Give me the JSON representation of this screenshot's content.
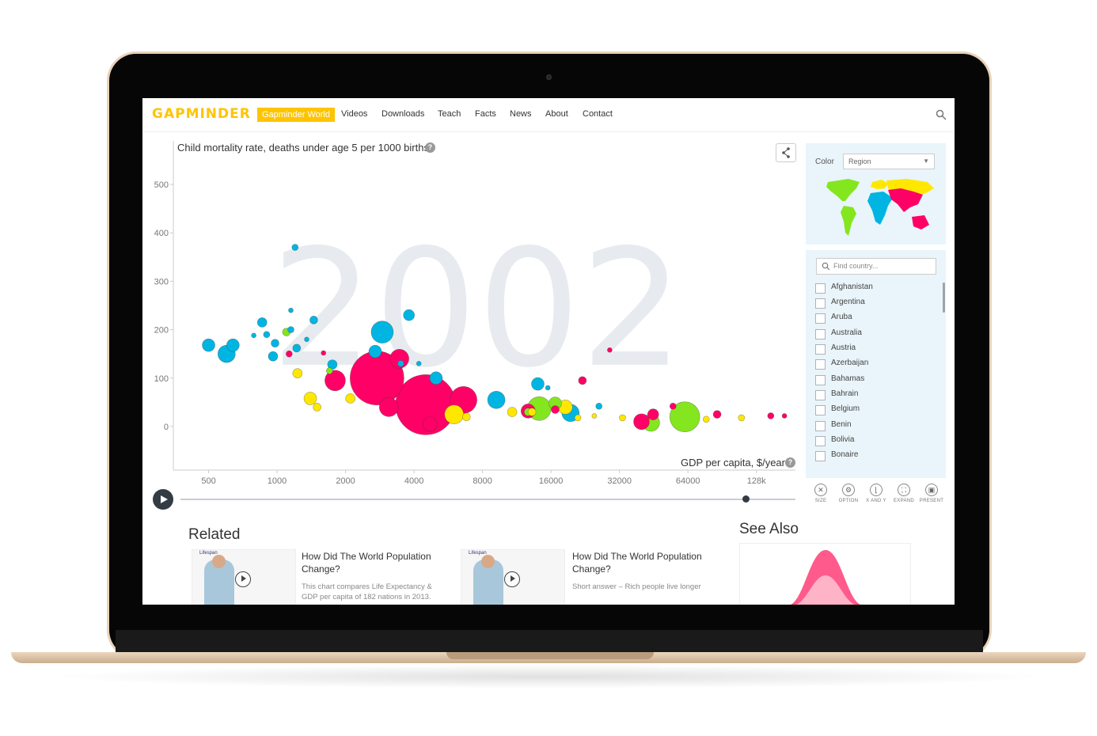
{
  "nav": {
    "logo": "GAPMINDER",
    "active": "Gapminder World",
    "items": [
      "Videos",
      "Downloads",
      "Teach",
      "Facts",
      "News",
      "About",
      "Contact"
    ]
  },
  "chart": {
    "y_title": "Child mortality rate, deaths under age 5 per 1000 births",
    "x_title": "GDP per capita, $/year",
    "help": "?",
    "year": "2002"
  },
  "chart_data": {
    "type": "scatter",
    "xlabel": "GDP per capita, $/year",
    "ylabel": "Child mortality rate, deaths under age 5 per 1000 births",
    "x_scale": "log",
    "xlim": [
      350,
      190000
    ],
    "ylim": [
      -90,
      590
    ],
    "x_ticks": [
      500,
      1000,
      2000,
      4000,
      8000,
      16000,
      32000,
      64000,
      128000
    ],
    "x_tick_labels": [
      "500",
      "1000",
      "2000",
      "4000",
      "8000",
      "16000",
      "32000",
      "64000",
      "128k"
    ],
    "y_ticks": [
      0,
      100,
      200,
      300,
      400,
      500
    ],
    "year_label": "2002",
    "region_colors": {
      "africa": "#00b5e2",
      "asia": "#ff0066",
      "americas": "#84e61f",
      "europe": "#ffe700"
    },
    "points": [
      {
        "x": 1200,
        "y": 370,
        "r": 4,
        "region": "africa"
      },
      {
        "x": 640,
        "y": 168,
        "r": 8,
        "region": "africa"
      },
      {
        "x": 860,
        "y": 215,
        "r": 6,
        "region": "africa"
      },
      {
        "x": 1150,
        "y": 240,
        "r": 3,
        "region": "africa"
      },
      {
        "x": 980,
        "y": 172,
        "r": 5,
        "region": "africa"
      },
      {
        "x": 900,
        "y": 190,
        "r": 4,
        "region": "africa"
      },
      {
        "x": 1450,
        "y": 220,
        "r": 5,
        "region": "africa"
      },
      {
        "x": 600,
        "y": 150,
        "r": 11,
        "region": "africa"
      },
      {
        "x": 960,
        "y": 145,
        "r": 6,
        "region": "africa"
      },
      {
        "x": 1150,
        "y": 200,
        "r": 4,
        "region": "africa"
      },
      {
        "x": 790,
        "y": 188,
        "r": 3,
        "region": "africa"
      },
      {
        "x": 1350,
        "y": 180,
        "r": 3,
        "region": "africa"
      },
      {
        "x": 1220,
        "y": 162,
        "r": 5,
        "region": "africa"
      },
      {
        "x": 500,
        "y": 168,
        "r": 8,
        "region": "africa"
      },
      {
        "x": 2900,
        "y": 195,
        "r": 14,
        "region": "africa"
      },
      {
        "x": 3800,
        "y": 230,
        "r": 7,
        "region": "africa"
      },
      {
        "x": 2700,
        "y": 155,
        "r": 8,
        "region": "africa"
      },
      {
        "x": 1750,
        "y": 128,
        "r": 6,
        "region": "africa"
      },
      {
        "x": 3500,
        "y": 130,
        "r": 4,
        "region": "africa"
      },
      {
        "x": 4200,
        "y": 130,
        "r": 3,
        "region": "africa"
      },
      {
        "x": 5000,
        "y": 100,
        "r": 8,
        "region": "africa"
      },
      {
        "x": 9200,
        "y": 55,
        "r": 11,
        "region": "africa"
      },
      {
        "x": 14000,
        "y": 88,
        "r": 8,
        "region": "africa"
      },
      {
        "x": 15500,
        "y": 80,
        "r": 3,
        "region": "africa"
      },
      {
        "x": 19500,
        "y": 28,
        "r": 11,
        "region": "africa"
      },
      {
        "x": 26000,
        "y": 42,
        "r": 4,
        "region": "africa"
      },
      {
        "x": 1130,
        "y": 150,
        "r": 4,
        "region": "asia"
      },
      {
        "x": 1600,
        "y": 152,
        "r": 3,
        "region": "asia"
      },
      {
        "x": 1800,
        "y": 95,
        "r": 13,
        "region": "asia"
      },
      {
        "x": 2750,
        "y": 100,
        "r": 34,
        "region": "asia"
      },
      {
        "x": 3450,
        "y": 140,
        "r": 12,
        "region": "asia"
      },
      {
        "x": 3100,
        "y": 40,
        "r": 12,
        "region": "asia"
      },
      {
        "x": 4500,
        "y": 45,
        "r": 38,
        "region": "asia"
      },
      {
        "x": 4700,
        "y": 5,
        "r": 9,
        "region": "asia"
      },
      {
        "x": 6600,
        "y": 55,
        "r": 17,
        "region": "asia"
      },
      {
        "x": 12700,
        "y": 32,
        "r": 9,
        "region": "asia"
      },
      {
        "x": 16700,
        "y": 35,
        "r": 5,
        "region": "asia"
      },
      {
        "x": 22000,
        "y": 95,
        "r": 5,
        "region": "asia"
      },
      {
        "x": 29000,
        "y": 158,
        "r": 3,
        "region": "asia"
      },
      {
        "x": 40000,
        "y": 10,
        "r": 10,
        "region": "asia"
      },
      {
        "x": 45000,
        "y": 25,
        "r": 7,
        "region": "asia"
      },
      {
        "x": 55000,
        "y": 42,
        "r": 4,
        "region": "asia"
      },
      {
        "x": 86000,
        "y": 25,
        "r": 5,
        "region": "asia"
      },
      {
        "x": 148000,
        "y": 22,
        "r": 4,
        "region": "asia"
      },
      {
        "x": 170000,
        "y": 22,
        "r": 3,
        "region": "asia"
      },
      {
        "x": 1100,
        "y": 195,
        "r": 5,
        "region": "americas"
      },
      {
        "x": 1700,
        "y": 115,
        "r": 4,
        "region": "americas"
      },
      {
        "x": 14200,
        "y": 37,
        "r": 15,
        "region": "americas"
      },
      {
        "x": 16700,
        "y": 48,
        "r": 8,
        "region": "americas"
      },
      {
        "x": 12700,
        "y": 30,
        "r": 5,
        "region": "americas"
      },
      {
        "x": 44000,
        "y": 8,
        "r": 11,
        "region": "americas"
      },
      {
        "x": 62000,
        "y": 20,
        "r": 19,
        "region": "americas"
      },
      {
        "x": 1230,
        "y": 110,
        "r": 6,
        "region": "europe"
      },
      {
        "x": 1400,
        "y": 58,
        "r": 8,
        "region": "europe"
      },
      {
        "x": 1500,
        "y": 40,
        "r": 5,
        "region": "europe"
      },
      {
        "x": 2100,
        "y": 58,
        "r": 6,
        "region": "europe"
      },
      {
        "x": 6000,
        "y": 25,
        "r": 12,
        "region": "europe"
      },
      {
        "x": 6800,
        "y": 20,
        "r": 5,
        "region": "europe"
      },
      {
        "x": 10800,
        "y": 30,
        "r": 6,
        "region": "europe"
      },
      {
        "x": 13200,
        "y": 30,
        "r": 5,
        "region": "europe"
      },
      {
        "x": 18500,
        "y": 40,
        "r": 9,
        "region": "europe"
      },
      {
        "x": 21000,
        "y": 18,
        "r": 4,
        "region": "europe"
      },
      {
        "x": 24800,
        "y": 22,
        "r": 3,
        "region": "europe"
      },
      {
        "x": 33000,
        "y": 18,
        "r": 4,
        "region": "europe"
      },
      {
        "x": 77000,
        "y": 15,
        "r": 4,
        "region": "europe"
      },
      {
        "x": 110000,
        "y": 18,
        "r": 4,
        "region": "europe"
      }
    ]
  },
  "panel": {
    "color_label": "Color",
    "color_value": "Region",
    "find_placeholder": "Find country...",
    "countries": [
      "Afghanistan",
      "Argentina",
      "Aruba",
      "Australia",
      "Austria",
      "Azerbaijan",
      "Bahamas",
      "Bahrain",
      "Belgium",
      "Benin",
      "Bolivia",
      "Bonaire"
    ],
    "tools": [
      "SIZE",
      "OPTION",
      "X AND Y",
      "EXPAND",
      "PRESENT"
    ]
  },
  "related": {
    "title": "Related",
    "see_also": "See Also",
    "thumb_label": "Lifespan",
    "cards": [
      {
        "title": "How Did The World Population Change?",
        "desc": "This chart compares Life Expectancy & GDP per capita of 182 nations in 2013."
      },
      {
        "title": "How Did The World Population Change?",
        "desc": "Short answer – Rich people live longer"
      }
    ]
  }
}
